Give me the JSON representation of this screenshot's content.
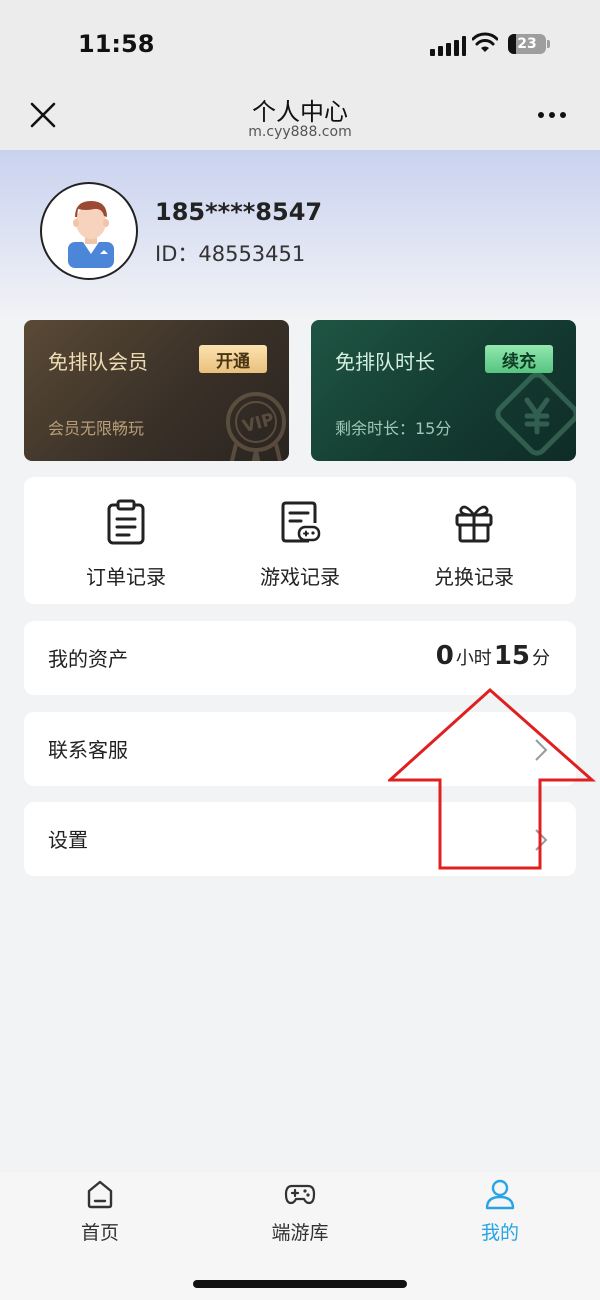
{
  "status_bar": {
    "time": "11:58",
    "battery": "23"
  },
  "nav": {
    "title": "个人中心",
    "url": "m.cyy888.com"
  },
  "profile": {
    "phone": "185****8547",
    "id_text": "ID：48553451"
  },
  "cards": {
    "vip": {
      "title": "免排队会员",
      "button": "开通",
      "subtitle": "会员无限畅玩",
      "badge_text": "VIP"
    },
    "time": {
      "title": "免排队时长",
      "button": "续充",
      "subtitle": "剩余时长：15分"
    }
  },
  "records": [
    {
      "label": "订单记录",
      "icon": "clipboard-icon"
    },
    {
      "label": "游戏记录",
      "icon": "document-gamepad-icon"
    },
    {
      "label": "兑换记录",
      "icon": "gift-icon"
    }
  ],
  "assets": {
    "label": "我的资产",
    "hours": "0",
    "hours_unit": "小时",
    "minutes": "15",
    "minutes_unit": "分"
  },
  "menu": {
    "contact": "联系客服",
    "settings": "设置"
  },
  "tabbar": [
    {
      "label": "首页",
      "icon": "home-icon",
      "active": false
    },
    {
      "label": "端游库",
      "icon": "gamepad-icon",
      "active": false
    },
    {
      "label": "我的",
      "icon": "person-icon",
      "active": true
    }
  ],
  "colors": {
    "accent_blue": "#27a4e6",
    "annotation_arrow": "#e02020",
    "vip_card": "#3a3128",
    "time_card": "#153e33"
  }
}
